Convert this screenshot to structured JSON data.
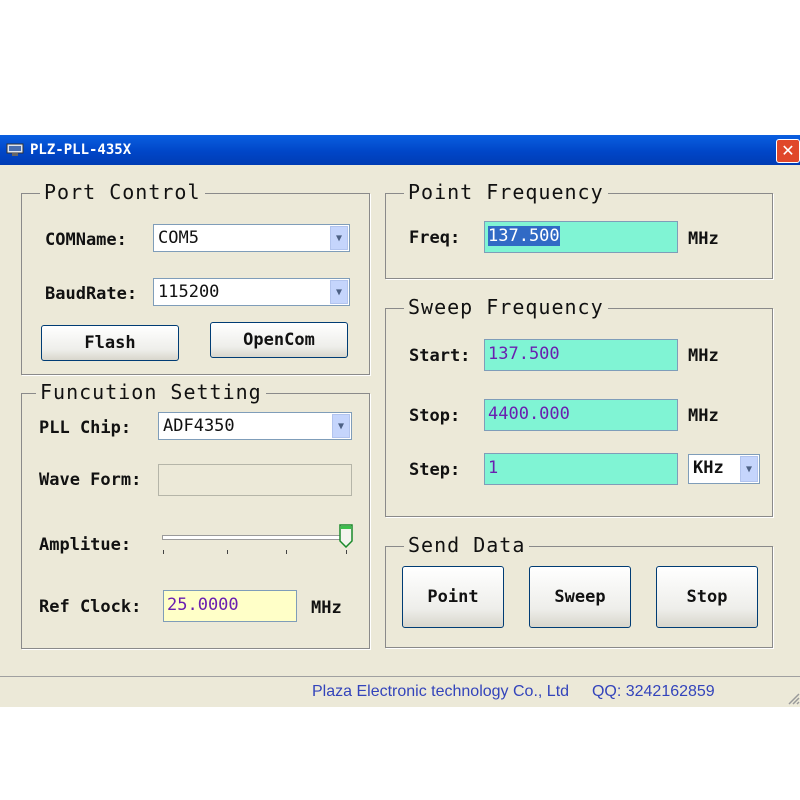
{
  "window": {
    "title": "PLZ-PLL-435X",
    "close_label": "✕"
  },
  "port_control": {
    "legend": "Port Control",
    "com_label": "COMName:",
    "com_value": "COM5",
    "baud_label": "BaudRate:",
    "baud_value": "115200",
    "flash_label": "Flash",
    "opencom_label": "OpenCom"
  },
  "function_setting": {
    "legend": "Funcution Setting",
    "chip_label": "PLL Chip:",
    "chip_value": "ADF4350",
    "wave_label": "Wave Form:",
    "wave_value": "",
    "amp_label": "Amplitue:",
    "amp_level": 1.0,
    "ref_label": "Ref Clock:",
    "ref_value": "25.0000",
    "ref_unit": "MHz"
  },
  "point_frequency": {
    "legend": "Point Frequency",
    "freq_label": "Freq:",
    "freq_value": "137.500",
    "freq_unit": "MHz"
  },
  "sweep_frequency": {
    "legend": "Sweep Frequency",
    "start_label": "Start:",
    "start_value": "137.500",
    "start_unit": "MHz",
    "stop_label": "Stop:",
    "stop_value": "4400.000",
    "stop_unit": "MHz",
    "step_label": "Step:",
    "step_value": "1",
    "step_unit": "KHz"
  },
  "send_data": {
    "legend": "Send Data",
    "point_label": "Point",
    "sweep_label": "Sweep",
    "stop_label": "Stop"
  },
  "status_bar": {
    "company": "Plaza Electronic technology Co., Ltd",
    "qq": "QQ: 3242162859"
  },
  "colors": {
    "field_teal": "#80f4d4",
    "field_yellow": "#ffffc8",
    "value_text": "#6a1fb0",
    "title_blue": "#0a5fe0"
  }
}
